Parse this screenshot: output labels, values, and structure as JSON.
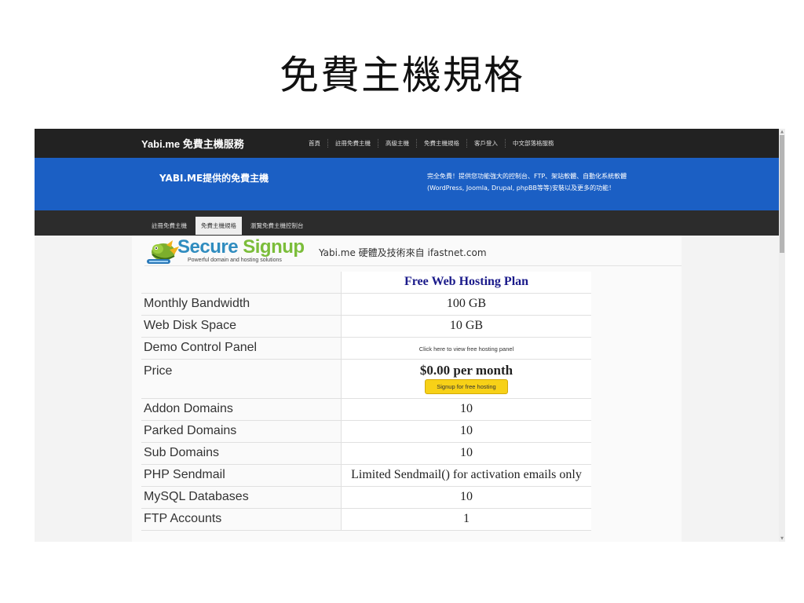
{
  "slide": {
    "title": "免費主機規格"
  },
  "topnav": {
    "brand": "Yabi.me 免費主機服務",
    "links": [
      "首頁",
      "註冊免費主機",
      "高級主機",
      "免費主機規格",
      "客戶登入",
      "中文部落格服務"
    ]
  },
  "hero": {
    "title": "YABI.ME提供的免費主機",
    "desc_line1": "完全免費！提供您功能強大的控制台、FTP、架站軟體、自動化系統軟體",
    "desc_line2": "(WordPress, Joomla, Drupal, phpBB等等)安裝以及更多的功能！"
  },
  "subnav": {
    "tabs": [
      {
        "label": "註冊免費主機"
      },
      {
        "label": "免費主機規格"
      },
      {
        "label": "瀏覽免費主機控制台"
      }
    ]
  },
  "logo": {
    "title_a": "Secure",
    "title_b": "Signup",
    "tagline": "Powerful domain and hosting solutions"
  },
  "credit": "Yabi.me 硬體及技術來自 ifastnet.com",
  "plan": {
    "name": "Free Web Hosting Plan"
  },
  "specs": [
    {
      "label": "Monthly Bandwidth",
      "value": "100 GB"
    },
    {
      "label": "Web Disk Space",
      "value": "10 GB"
    },
    {
      "label": "Demo Control Panel",
      "value": "Click here to view free hosting panel"
    },
    {
      "label": "Price",
      "value": "$0.00 per month",
      "button": "Signup for free hosting"
    },
    {
      "label": "Addon Domains",
      "value": "10"
    },
    {
      "label": "Parked Domains",
      "value": "10"
    },
    {
      "label": "Sub Domains",
      "value": "10"
    },
    {
      "label": "PHP Sendmail",
      "value": "Limited Sendmail() for activation emails only"
    },
    {
      "label": "MySQL Databases",
      "value": "10"
    },
    {
      "label": "FTP Accounts",
      "value": "1"
    }
  ],
  "colors": {
    "hero": "#1b5fc4",
    "nav": "#222222",
    "plan_title": "#1a1a8a",
    "signup_button": "#f7d117"
  }
}
